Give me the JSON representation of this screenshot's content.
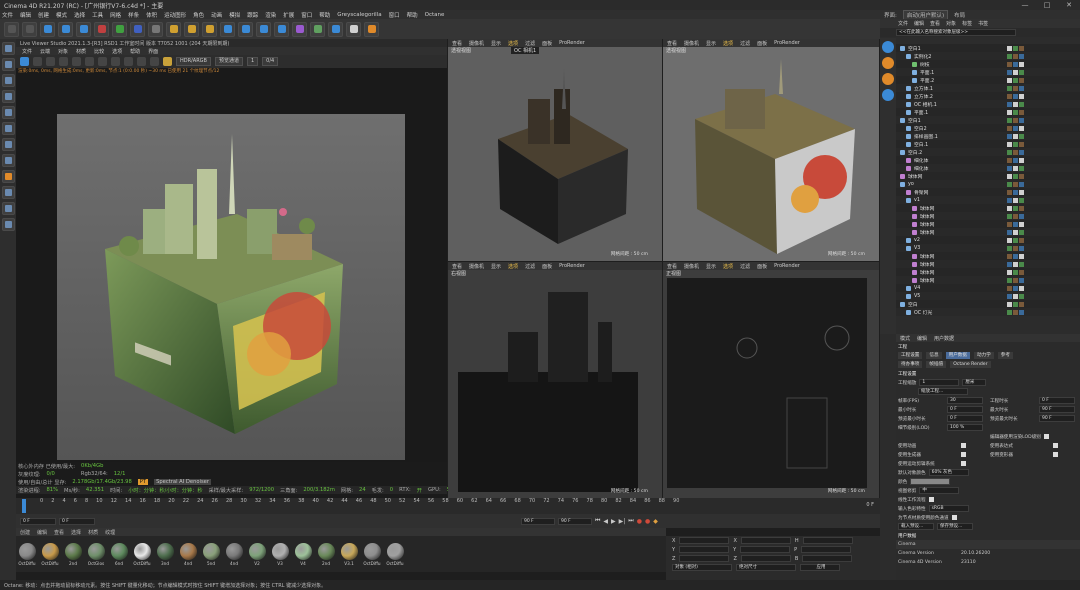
{
  "window": {
    "title": "Cinema 4D R21.207 (RC) - [广州银行V7-6.c4d *] - 主要",
    "controls": [
      "—",
      "□",
      "✕"
    ]
  },
  "menubar": {
    "items": [
      "文件",
      "编辑",
      "创建",
      "模式",
      "选择",
      "工具",
      "网格",
      "样条",
      "体积",
      "运动图形",
      "角色",
      "动画",
      "模拟",
      "跟踪",
      "渲染",
      "扩展",
      "窗口",
      "帮助",
      "Greyscalegorilla",
      "窗口",
      "帮助",
      "Octane"
    ],
    "right": {
      "label": "界面:",
      "value": "启动(用户默认)",
      "extra": "布局"
    }
  },
  "toolbar": {
    "icons": [
      "undo-icon",
      "redo-icon",
      "move-icon",
      "scale-icon",
      "rotate-icon",
      "x-axis-icon",
      "y-axis-icon",
      "z-axis-icon",
      "coord-icon",
      "render-view-icon",
      "render-icon",
      "render-settings-icon",
      "cube-icon",
      "pen-icon",
      "subdivision-icon",
      "array-icon",
      "deformer-icon",
      "scene-icon",
      "camera-icon",
      "light-icon",
      "octane-icon"
    ]
  },
  "live_viewer": {
    "header": "Live Viewer Studio 2021.1.3-[R3]  RSD1 工作室时间  版本  T7052 1001 (204 天期限到期)",
    "menu": [
      "文件",
      "云端",
      "对象",
      "材质",
      "比较",
      "选项",
      "帮助",
      "界面"
    ],
    "mode_dropdown": "HDR/ARGB",
    "channel_dropdown": "预览通道",
    "page": "1",
    "page_count": "0/4",
    "status_line": "渲染:0ms, 0ms, 网格生成:0ms, 更新:0ms, 节点:1 (0:0.00 秒) ~30 ms 已使用 21 个纹理节点/12",
    "stats": {
      "mem_label": "核心外内存 已使用/最大:",
      "mem_value": "0Kb/4Gb",
      "gray_label": "灰度纹理:",
      "gray_value": "0/0",
      "rgb_label": "Rgb32/64:",
      "rgb_value": "12/1",
      "vram_label": "使用/自由/总计 显存:",
      "vram_value": "2.178Gb/17.4Gb/23.98",
      "pt_tag": "PT",
      "denoise_tag": "Spectral AI Denoiser",
      "progress_label": "渲染进程:",
      "progress_value": "81%",
      "ms_label": "Ms/秒:",
      "ms_value": "42.351",
      "time_label": "时间:",
      "time_value": "小时：分钟：秒/小时：分钟：秒",
      "spp_label": "采样/最大采样:",
      "spp_value": "972/1200",
      "tri_label": "三角面:",
      "tri_value": "200/3.182m",
      "mesh_label": "网格:",
      "mesh_value": "24",
      "hair_label": "毛发:",
      "hair_value": "0",
      "rtx_label": "RTX:",
      "rtx_value": "开",
      "gpu_label": "GPU:",
      "gpu_value": "54"
    }
  },
  "viewports": [
    {
      "label": "透视视图",
      "camera": "OC 相机1",
      "menu": [
        "查看",
        "摄像机",
        "显示",
        "选项",
        "过滤",
        "面板",
        "ProRender"
      ],
      "footer": "网格间距 : 50 cm"
    },
    {
      "label": "透视视图",
      "camera": "",
      "menu": [
        "查看",
        "摄像机",
        "显示",
        "选项",
        "过滤",
        "面板",
        "ProRender"
      ],
      "footer": "网格间距 : 50 cm"
    },
    {
      "label": "右视图",
      "camera": "",
      "menu": [
        "查看",
        "摄像机",
        "显示",
        "选项",
        "过滤",
        "面板",
        "ProRender"
      ],
      "footer": "网格间距 : 50 cm"
    },
    {
      "label": "正视图",
      "camera": "",
      "menu": [
        "查看",
        "摄像机",
        "显示",
        "选项",
        "过滤",
        "面板",
        "ProRender"
      ],
      "footer": "网格间距 : 50 cm"
    }
  ],
  "timeline": {
    "ticks": [
      "0",
      "2",
      "4",
      "6",
      "8",
      "10",
      "12",
      "14",
      "16",
      "18",
      "20",
      "22",
      "24",
      "26",
      "28",
      "30",
      "32",
      "34",
      "36",
      "38",
      "40",
      "42",
      "44",
      "46",
      "48",
      "50",
      "52",
      "54",
      "56",
      "58",
      "60",
      "62",
      "64",
      "66",
      "68",
      "70",
      "72",
      "74",
      "76",
      "78",
      "80",
      "82",
      "84",
      "86",
      "88",
      "90"
    ],
    "current_frame": "0 F",
    "start": "0 F",
    "end": "90 F",
    "end2": "90 F",
    "frame_field": "0 F"
  },
  "materials": {
    "menu": [
      "创建",
      "编辑",
      "查看",
      "选择",
      "材质",
      "纹理"
    ],
    "items": [
      {
        "name": "OctDiffu",
        "color": "#8a8a8a"
      },
      {
        "name": "OctDiffu",
        "color": "#c89a4a"
      },
      {
        "name": "2nd",
        "color": "#5c7a4a"
      },
      {
        "name": "OctGlos",
        "color": "#6f8f6a"
      },
      {
        "name": "6nd",
        "color": "#5e8a5e"
      },
      {
        "name": "OctDiffu",
        "color": "#e8e8e8"
      },
      {
        "name": "3nd",
        "color": "#4e6e4e"
      },
      {
        "name": "4nd",
        "color": "#a8794a"
      },
      {
        "name": "5nd",
        "color": "#8aa07a"
      },
      {
        "name": "4nd",
        "color": "#7a7a7a"
      },
      {
        "name": "V2",
        "color": "#7ea27a"
      },
      {
        "name": "V3",
        "color": "#b0b0b0"
      },
      {
        "name": "V4",
        "color": "#9ec29a"
      },
      {
        "name": "2nd",
        "color": "#6a8a5a"
      },
      {
        "name": "V3.1",
        "color": "#c8a85a"
      },
      {
        "name": "OctDiffu",
        "color": "#8e8e8e"
      },
      {
        "name": "OctDiffu",
        "color": "#a0a0a0"
      }
    ]
  },
  "coords": {
    "rows": [
      {
        "a": "X",
        "b": "X",
        "c": "H"
      },
      {
        "a": "Y",
        "b": "Y",
        "c": "P"
      },
      {
        "a": "Z",
        "b": "Z",
        "c": "B"
      }
    ],
    "mode": "对象 (相对)",
    "size_mode": "绝对尺寸",
    "apply": "应用"
  },
  "statusbar": "Octane: 移动：点击并拖动鼠标移动元素。按住 SHIFT 键量化移动；节点编辑模式时按住 SHIFT 键增加选择对象；按住 CTRL 键减少选择对象。",
  "right_panel": {
    "tabs": [
      "文件",
      "编辑",
      "查看",
      "对象",
      "标签",
      "书签"
    ],
    "search_placeholder": "<<在此输入名称搜索对象层级>>",
    "objects": [
      {
        "name": "空白1",
        "indent": 0,
        "color": "#7fb0e0"
      },
      {
        "name": "实例化2",
        "indent": 1,
        "color": "#7fb0e0"
      },
      {
        "name": "树枝",
        "indent": 2,
        "color": "#6fc06f"
      },
      {
        "name": "平面.1",
        "indent": 2,
        "color": "#7fb0e0"
      },
      {
        "name": "平面.2",
        "indent": 2,
        "color": "#7fb0e0"
      },
      {
        "name": "立方体.1",
        "indent": 1,
        "color": "#7fb0e0"
      },
      {
        "name": "立方体.2",
        "indent": 1,
        "color": "#7fb0e0"
      },
      {
        "name": "OC 相机.1",
        "indent": 1,
        "color": "#7fb0e0"
      },
      {
        "name": "平面.1",
        "indent": 1,
        "color": "#7fb0e0"
      },
      {
        "name": "空白1",
        "indent": 0,
        "color": "#7fb0e0"
      },
      {
        "name": "空白2",
        "indent": 1,
        "color": "#7fb0e0"
      },
      {
        "name": "排样画图.1",
        "indent": 1,
        "color": "#7fb0e0"
      },
      {
        "name": "空白.1",
        "indent": 1,
        "color": "#7fb0e0"
      },
      {
        "name": "空白.2",
        "indent": 0,
        "color": "#7fb0e0"
      },
      {
        "name": "细化体",
        "indent": 1,
        "color": "#c07fd0"
      },
      {
        "name": "细化体",
        "indent": 1,
        "color": "#c07fd0"
      },
      {
        "name": "球体网",
        "indent": 0,
        "color": "#c07fd0"
      },
      {
        "name": "yo",
        "indent": 0,
        "color": "#7fb0e0"
      },
      {
        "name": "骨架网",
        "indent": 1,
        "color": "#c07fd0"
      },
      {
        "name": "v1",
        "indent": 1,
        "color": "#7fb0e0"
      },
      {
        "name": "球体网",
        "indent": 2,
        "color": "#c07fd0"
      },
      {
        "name": "球体网",
        "indent": 2,
        "color": "#c07fd0"
      },
      {
        "name": "球体网",
        "indent": 2,
        "color": "#c07fd0"
      },
      {
        "name": "球体网",
        "indent": 2,
        "color": "#c07fd0"
      },
      {
        "name": "v2",
        "indent": 1,
        "color": "#7fb0e0"
      },
      {
        "name": "V3",
        "indent": 1,
        "color": "#7fb0e0"
      },
      {
        "name": "球体网",
        "indent": 2,
        "color": "#c07fd0"
      },
      {
        "name": "球体网",
        "indent": 2,
        "color": "#c07fd0"
      },
      {
        "name": "球体网",
        "indent": 2,
        "color": "#c07fd0"
      },
      {
        "name": "球体网",
        "indent": 2,
        "color": "#c07fd0"
      },
      {
        "name": "V4",
        "indent": 1,
        "color": "#7fb0e0"
      },
      {
        "name": "V5",
        "indent": 1,
        "color": "#7fb0e0"
      },
      {
        "name": "空白",
        "indent": 0,
        "color": "#7fb0e0"
      },
      {
        "name": "OC 灯光",
        "indent": 1,
        "color": "#7fb0e0"
      }
    ],
    "attr_tabs": [
      "模式",
      "编辑",
      "用户数据"
    ],
    "attr_title": "工程",
    "attr_pills": [
      "工程设置",
      "信息",
      "用户数据",
      "动力学",
      "参考"
    ],
    "attr_pills2": [
      "待办事项",
      "帧插值",
      "Octane Render"
    ],
    "section": "工程设置",
    "scale_label": "工程缩放",
    "scale_value": "1",
    "scale_unit": "厘米",
    "scale_button": "缩放工程...",
    "params_left": [
      {
        "label": "帧率(FPS)",
        "value": "30"
      },
      {
        "label": "最小时长",
        "value": "0 F"
      },
      {
        "label": "预览最小时长",
        "value": "0 F"
      },
      {
        "label": "细节级别(LOD)",
        "value": "100 %"
      }
    ],
    "params_right": [
      {
        "label": "工程时长",
        "value": "0 F"
      },
      {
        "label": "最大时长",
        "value": "90 F"
      },
      {
        "label": "预览最大时长",
        "value": "90 F"
      }
    ],
    "lod_right": "编辑器使用渲染LOD级别",
    "checks_left": [
      "使用动画",
      "使用生成器",
      "使用运动剪辑系统"
    ],
    "checks_right": [
      "使用表达式",
      "使用变形器"
    ],
    "default_color_label": "默认对象颜色",
    "default_color_value": "60% 灰色",
    "color_label": "颜色",
    "view_clip_label": "视图修剪",
    "view_clip_value": "中",
    "linear_label": "线性工作流程",
    "input_color_label": "输入色彩特性",
    "input_color_value": "sRGB",
    "node_label": "为节点材质使用颜色通道",
    "load_button": "载入预设...",
    "save_button": "保存预设...",
    "user_data": "用户数据",
    "octane_head": "Cinema",
    "version_label": "Cinema Version",
    "version_value": "20.10.26200",
    "c4d_label": "Cinema 4D Version",
    "c4d_value": "23110"
  }
}
